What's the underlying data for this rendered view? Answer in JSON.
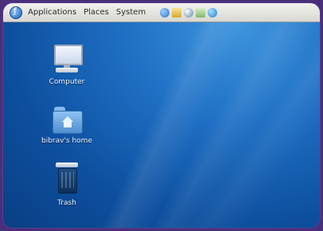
{
  "panel": {
    "menus": [
      {
        "label": "Applications"
      },
      {
        "label": "Places"
      },
      {
        "label": "System"
      }
    ],
    "launchers": [
      {
        "icon": "globe-icon"
      },
      {
        "icon": "mail-icon"
      },
      {
        "icon": "web-browser-icon"
      },
      {
        "icon": "document-icon"
      },
      {
        "icon": "help-icon"
      }
    ]
  },
  "desktop": {
    "icons": [
      {
        "label": "Computer",
        "icon": "computer-icon"
      },
      {
        "label": "bibrav's home",
        "icon": "home-folder-icon"
      },
      {
        "label": "Trash",
        "icon": "trash-icon"
      }
    ]
  },
  "colors": {
    "purple_frame": "#4a2f7a",
    "desktop_blue": "#1f6fc4",
    "panel_bg": "#e6e6e0"
  }
}
